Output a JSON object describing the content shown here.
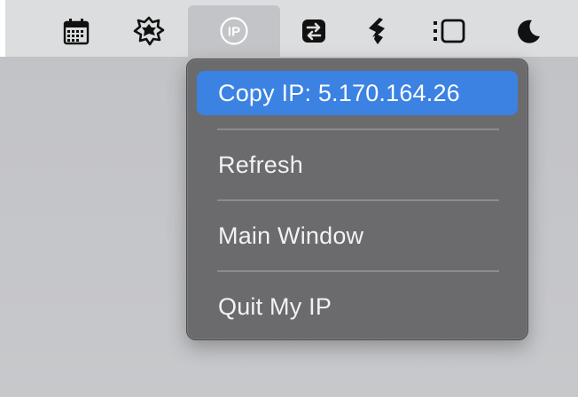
{
  "menubar": {
    "icons": [
      {
        "name": "calendar-icon",
        "active": false
      },
      {
        "name": "gear-badge-icon",
        "active": false
      },
      {
        "name": "ip-icon",
        "active": true
      },
      {
        "name": "transfer-arrows-icon",
        "active": false
      },
      {
        "name": "leaf-sync-icon",
        "active": false
      },
      {
        "name": "sidebar-list-icon",
        "active": false
      },
      {
        "name": "moon-icon",
        "active": false
      }
    ]
  },
  "dropdown": {
    "items": [
      {
        "label": "Copy IP: 5.170.164.26",
        "highlighted": true
      },
      {
        "label": "Refresh"
      },
      {
        "label": "Main Window"
      },
      {
        "label": "Quit My IP"
      }
    ]
  },
  "colors": {
    "menubar_bg": "#dcdddf",
    "menu_bg": "#6b6a6d",
    "highlight": "#3b82e2",
    "menu_text": "#f2f2f2"
  }
}
